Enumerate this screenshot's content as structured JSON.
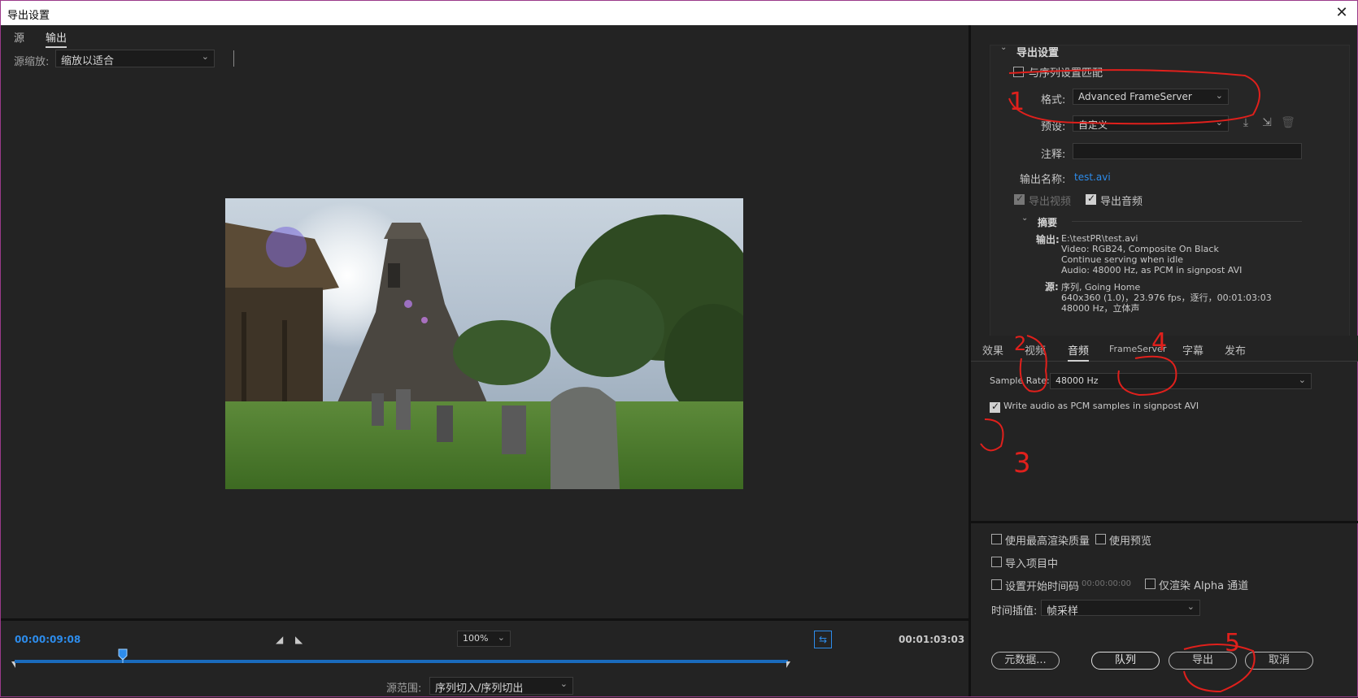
{
  "window": {
    "title": "导出设置",
    "close_glyph": "✕"
  },
  "left": {
    "tabs": [
      {
        "label": "源"
      },
      {
        "label": "输出"
      }
    ],
    "scale_label": "源缩放:",
    "scale_value": "缩放以适合",
    "timeline": {
      "current_tc": "00:00:09:08",
      "total_tc": "00:01:03:03",
      "zoom": "100%",
      "playhead_fraction": 0.14,
      "range_label": "源范围:",
      "range_value": "序列切入/序列切出"
    }
  },
  "right": {
    "export_settings_header": "导出设置",
    "match_sequence": "与序列设置匹配",
    "format_label": "格式:",
    "format_value": "Advanced FrameServer",
    "preset_label": "预设:",
    "preset_value": "自定义",
    "comment_label": "注释:",
    "output_name_label": "输出名称:",
    "output_name_value": "test.avi",
    "export_video": "导出视频",
    "export_audio": "导出音频",
    "summary_header": "摘要",
    "summary": {
      "output_key": "输出:",
      "output_lines": [
        "E:\\testPR\\test.avi",
        "Video: RGB24, Composite On Black",
        "Continue serving when idle",
        "Audio: 48000 Hz, as PCM in signpost AVI"
      ],
      "source_key": "源:",
      "source_lines": [
        "序列, Going Home",
        "640x360 (1.0)，23.976 fps，逐行，00:01:03:03",
        "48000 Hz，立体声"
      ]
    },
    "tabs": [
      {
        "label": "效果"
      },
      {
        "label": "视频"
      },
      {
        "label": "音频"
      },
      {
        "label": "FrameServer"
      },
      {
        "label": "字幕"
      },
      {
        "label": "发布"
      }
    ],
    "audio": {
      "sample_rate_label": "Sample Rate:",
      "sample_rate_value": "48000 Hz",
      "write_pcm_label": "Write audio as PCM samples in signpost AVI"
    },
    "bottom": {
      "max_quality": "使用最高渲染质量",
      "use_preview": "使用预览",
      "import_project": "导入项目中",
      "set_start_tc": "设置开始时间码",
      "start_tc_value": "00:00:00:00",
      "render_alpha": "仅渲染 Alpha 通道",
      "time_interp_label": "时间插值:",
      "time_interp_value": "帧采样",
      "metadata_btn": "元数据...",
      "queue_btn": "队列",
      "export_btn": "导出",
      "cancel_btn": "取消"
    },
    "annotations": [
      "1",
      "2",
      "3",
      "4",
      "5"
    ]
  },
  "colors": {
    "accent": "#2d8ceb",
    "annotation": "#e0201c"
  }
}
